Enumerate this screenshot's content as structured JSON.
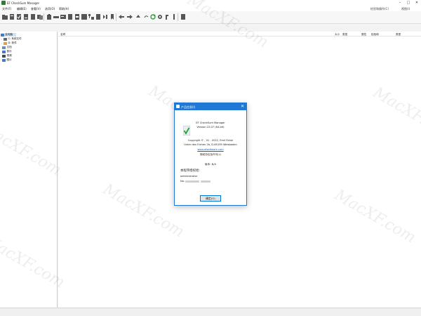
{
  "window": {
    "title": "EF CheckSum Manager",
    "controls": {
      "minimize": "–",
      "maximize": "□",
      "close": "✕"
    }
  },
  "menubar": {
    "items": [
      "文件(F)",
      "编辑(E)",
      "查看(V)",
      "选项(O)",
      "帮助(H)"
    ],
    "right": [
      "检验和操作(C)",
      "视图(I)"
    ]
  },
  "toolbar": {
    "buttons": [
      "folder-icon",
      "create-icon",
      "verify-icon",
      "recalc-icon",
      "refresh-icon",
      "copy-icon",
      "paste-icon",
      "delete-icon",
      "rename-icon",
      "properties-icon",
      "hash-icon",
      "filter-icon",
      "tree-icon",
      "back-icon",
      "forward-icon",
      "up-icon",
      "sync-icon",
      "settings-icon",
      "info-icon",
      "exit-icon"
    ]
  },
  "tree": {
    "items": [
      {
        "label": "此电脑",
        "icon": "computer-icon",
        "color": "#3a7bd5"
      },
      {
        "label": "C: 系统文件",
        "icon": "drive-icon",
        "color": "#5f6b7a"
      },
      {
        "label": "D: 软件",
        "icon": "drive-icon",
        "color": "#d9a441"
      },
      {
        "label": "文档",
        "icon": "documents-icon",
        "color": "#6b8fb3"
      },
      {
        "label": "音乐",
        "icon": "music-icon",
        "color": "#3a7bd5"
      },
      {
        "label": "视频",
        "icon": "video-icon",
        "color": "#444c56"
      },
      {
        "label": "图片",
        "icon": "pictures-icon",
        "color": "#3a7bd5"
      }
    ]
  },
  "list": {
    "columns": [
      "名称",
      "大小",
      "类型",
      "属性",
      "检验和",
      "类型"
    ]
  },
  "watermark": "MacXF.com",
  "dialog": {
    "title": "产品信息(I)",
    "close": "✕",
    "product": "EF CheckSum Manager",
    "version": "Version 22.07 (64-bit)",
    "copyright": "Copyright © , 01 - 2022, Emil Fickel",
    "address": "Unter den Eichen 2b, D-65195 Wiesbaden",
    "website": "www.efsoftware.com",
    "license_link": "授权协议及许可(L)",
    "edition_label": "版本: N/A",
    "registered_heading": "本程序授权给:",
    "registered_user": "administrator",
    "serial_label": "No.",
    "ok_button": "确定(O)",
    "brand_color": "#1e78d4"
  }
}
